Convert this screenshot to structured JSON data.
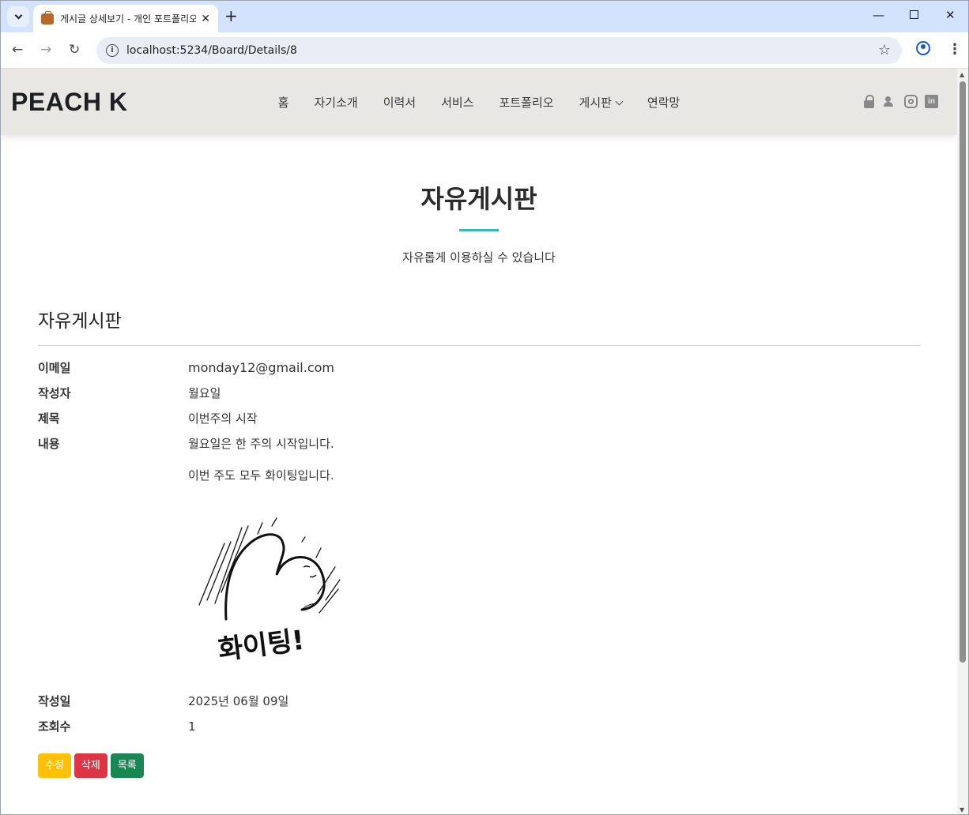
{
  "browser": {
    "tab_title": "게시글 상세보기 - 개인 포트폴리오",
    "url": "localhost:5234/Board/Details/8"
  },
  "site": {
    "logo": "PEACH K",
    "menu": [
      "홈",
      "자기소개",
      "이력서",
      "서비스",
      "포트폴리오",
      "게시판",
      "연락망"
    ],
    "social_icons": [
      "lock-icon",
      "users-icon",
      "instagram-icon",
      "linkedin-icon"
    ]
  },
  "hero": {
    "title": "자유게시판",
    "subtitle": "자유롭게 이용하실 수 있습니다"
  },
  "post": {
    "section_title": "자유게시판",
    "email_label": "이메일",
    "email": "monday12@gmail.com",
    "author_label": "작성자",
    "author": "월요일",
    "subject_label": "제목",
    "subject": "이번주의 시작",
    "content_label": "내용",
    "content_line1": "월요일은 한 주의 시작입니다.",
    "content_line2": "이번 주도 모두 화이팅입니다.",
    "image_caption": "화이팅!",
    "date_label": "작성일",
    "date": "2025년 06월 09일",
    "views_label": "조회수",
    "views": "1"
  },
  "buttons": {
    "edit": "수정",
    "delete": "삭제",
    "list": "목록"
  },
  "colors": {
    "accent": "#3ab5b0",
    "header_bg": "#e8e7e4",
    "edit": "#ffc107",
    "delete": "#dc3545",
    "list": "#198754"
  }
}
